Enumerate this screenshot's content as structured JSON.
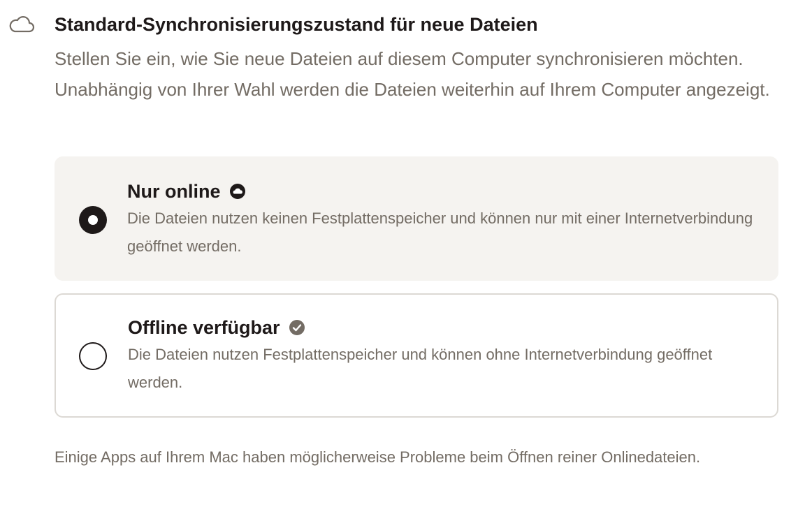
{
  "section": {
    "icon": "cloud-icon",
    "title": "Standard-Synchronisierungszustand für neue Dateien",
    "description": "Stellen Sie ein, wie Sie neue Dateien auf diesem Computer synchronisieren möchten. Unabhängig von Ihrer Wahl werden die Dateien weiterhin auf Ihrem Computer angezeigt."
  },
  "options": [
    {
      "title": "Nur online",
      "icon": "online-only-icon",
      "description": "Die Dateien nutzen keinen Festplattenspeicher und können nur mit einer Internetverbindung geöffnet werden.",
      "selected": true
    },
    {
      "title": "Offline verfügbar",
      "icon": "offline-available-check-icon",
      "description": "Die Dateien nutzen Festplattenspeicher und können ohne Internetverbindung geöffnet werden.",
      "selected": false
    }
  ],
  "footer": {
    "note": "Einige Apps auf Ihrem Mac haben möglicherweise Probleme beim Öffnen reiner Onlinedateien."
  },
  "colors": {
    "text_primary": "#1e1919",
    "text_secondary": "#736c64",
    "selected_background": "#f5f3f0",
    "card_border": "#dcd9d4"
  }
}
